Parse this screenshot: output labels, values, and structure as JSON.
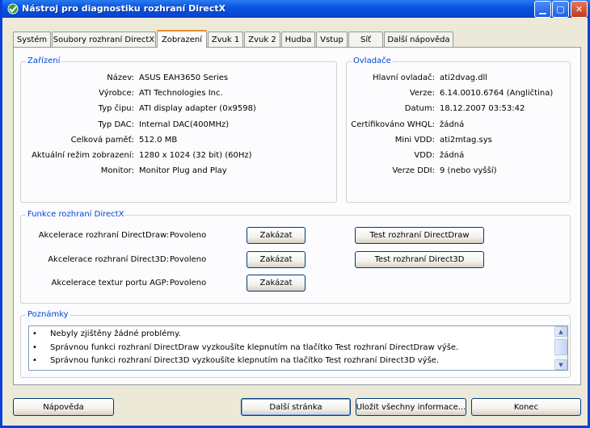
{
  "window": {
    "title": "Nástroj pro diagnostiku rozhraní DirectX",
    "min_glyph": "▁",
    "max_glyph": "▢",
    "close_glyph": "✕"
  },
  "tabs": [
    {
      "label": "Systém"
    },
    {
      "label": "Soubory rozhraní DirectX"
    },
    {
      "label": "Zobrazení"
    },
    {
      "label": "Zvuk 1"
    },
    {
      "label": "Zvuk 2"
    },
    {
      "label": "Hudba"
    },
    {
      "label": "Vstup"
    },
    {
      "label": "Síť"
    },
    {
      "label": "Další nápověda"
    }
  ],
  "device": {
    "title": "Zařízení",
    "rows": [
      {
        "label": "Název:",
        "value": "ASUS EAH3650 Series"
      },
      {
        "label": "Výrobce:",
        "value": "ATI Technologies Inc."
      },
      {
        "label": "Typ čipu:",
        "value": "ATI display adapter (0x9598)"
      },
      {
        "label": "Typ DAC:",
        "value": "Internal DAC(400MHz)"
      },
      {
        "label": "Celková paměť:",
        "value": "512.0 MB"
      },
      {
        "label": "Aktuální režim zobrazení:",
        "value": "1280 x 1024 (32 bit) (60Hz)"
      },
      {
        "label": "Monitor:",
        "value": "Monitor Plug and Play"
      }
    ]
  },
  "drivers": {
    "title": "Ovladače",
    "rows": [
      {
        "label": "Hlavní ovladač:",
        "value": "ati2dvag.dll"
      },
      {
        "label": "Verze:",
        "value": "6.14.0010.6764 (Angličtina)"
      },
      {
        "label": "Datum:",
        "value": "18.12.2007 03:53:42"
      },
      {
        "label": "Certifikováno WHQL:",
        "value": "žádná"
      },
      {
        "label": "Mini VDD:",
        "value": "ati2mtag.sys"
      },
      {
        "label": "VDD:",
        "value": "žádná"
      },
      {
        "label": "Verze DDI:",
        "value": "9 (nebo vyšší)"
      }
    ]
  },
  "features": {
    "title": "Funkce rozhraní DirectX",
    "rows": [
      {
        "label": "Akcelerace rozhraní DirectDraw:",
        "value": "Povoleno",
        "button": "Zakázat",
        "test": "Test rozhraní DirectDraw"
      },
      {
        "label": "Akcelerace rozhraní Direct3D:",
        "value": "Povoleno",
        "button": "Zakázat",
        "test": "Test rozhraní Direct3D"
      },
      {
        "label": "Akcelerace textur portu AGP:",
        "value": "Povoleno",
        "button": "Zakázat"
      }
    ]
  },
  "notes": {
    "title": "Poznámky",
    "bullet": "•",
    "lines": [
      "Nebyly zjištěny žádné problémy.",
      "Správnou funkci rozhraní DirectDraw vyzkoušíte klepnutím na tlačítko Test rozhraní DirectDraw výše.",
      "Správnou funkci rozhraní Direct3D vyzkoušíte klepnutím na tlačítko Test rozhraní Direct3D výše."
    ],
    "up_glyph": "▲",
    "down_glyph": "▼"
  },
  "footer": {
    "help": "Nápověda",
    "next": "Další stránka",
    "save": "Uložit všechny informace...",
    "exit": "Konec"
  }
}
